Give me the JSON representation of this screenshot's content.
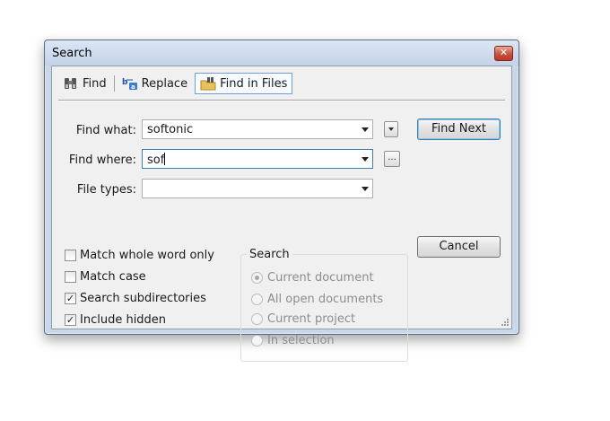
{
  "window": {
    "title": "Search",
    "close_glyph": "✕"
  },
  "tabs": [
    {
      "label": "Find",
      "icon": "binoculars-icon"
    },
    {
      "label": "Replace",
      "icon": "replace-icon"
    },
    {
      "label": "Find in Files",
      "icon": "find-in-files-icon",
      "active": true
    }
  ],
  "fields": {
    "find_what": {
      "label": "Find what:",
      "value": "softonic"
    },
    "find_where": {
      "label": "Find where:",
      "value": "sof"
    },
    "file_types": {
      "label": "File types:",
      "value": ""
    }
  },
  "browse_label": "...",
  "buttons": {
    "find_next": "Find Next",
    "cancel": "Cancel"
  },
  "options": [
    {
      "label": "Match whole word only",
      "checked": false
    },
    {
      "label": "Match case",
      "checked": false
    },
    {
      "label": "Search subdirectories",
      "checked": true
    },
    {
      "label": "Include hidden",
      "checked": true
    }
  ],
  "check_glyph": "✓",
  "search_scope": {
    "title": "Search",
    "enabled": false,
    "items": [
      {
        "label": "Current document",
        "selected": true
      },
      {
        "label": "All open documents",
        "selected": false
      },
      {
        "label": "Current project",
        "selected": false
      },
      {
        "label": "In selection",
        "selected": false
      }
    ]
  },
  "colors": {
    "active_tab_border": "#6f9fd8",
    "default_button_border": "#3c7fb1",
    "close_button": "#c9503d"
  }
}
